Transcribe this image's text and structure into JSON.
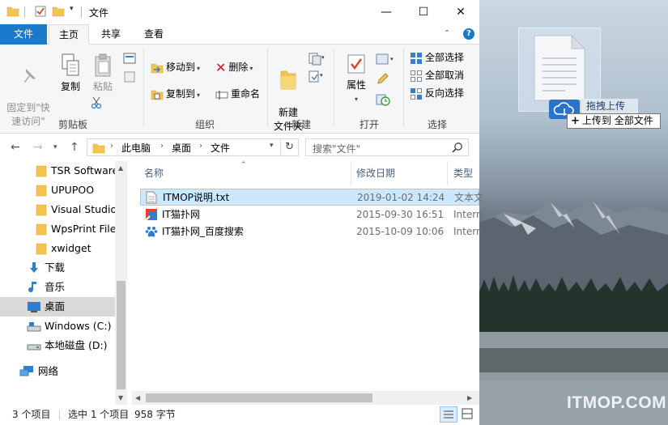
{
  "window": {
    "title": "文件",
    "controls": {
      "minimize": "—",
      "maximize": "☐",
      "close": "✕"
    }
  },
  "ribbon_tabs": {
    "file": "文件",
    "home": "主页",
    "share": "共享",
    "view": "查看",
    "help": "?"
  },
  "ribbon": {
    "clipboard": {
      "pin": "固定到\"快速访问\"",
      "copy": "复制",
      "paste": "粘贴",
      "label": "剪贴板"
    },
    "organize": {
      "move_to": "移动到",
      "copy_to": "复制到",
      "delete": "删除",
      "rename": "重命名",
      "label": "组织"
    },
    "new": {
      "new_folder": "新建\n文件夹",
      "label": "新建"
    },
    "open": {
      "properties": "属性",
      "label": "打开"
    },
    "select": {
      "select_all": "全部选择",
      "select_none": "全部取消",
      "invert": "反向选择",
      "label": "选择"
    }
  },
  "address": {
    "crumbs": [
      "此电脑",
      "桌面",
      "文件"
    ],
    "search_placeholder": "搜索\"文件\""
  },
  "nav_pane": [
    {
      "label": "TSR Software",
      "icon": "folder-icon"
    },
    {
      "label": "UPUPOO",
      "icon": "folder-icon"
    },
    {
      "label": "Visual Studio",
      "icon": "folder-icon"
    },
    {
      "label": "WpsPrint Files",
      "icon": "folder-icon"
    },
    {
      "label": "xwidget",
      "icon": "folder-icon"
    },
    {
      "label": "下载",
      "icon": "download-icon"
    },
    {
      "label": "音乐",
      "icon": "music-icon"
    },
    {
      "label": "桌面",
      "icon": "desktop-icon"
    },
    {
      "label": "Windows (C:)",
      "icon": "drive-c-icon"
    },
    {
      "label": "本地磁盘 (D:)",
      "icon": "drive-d-icon"
    },
    {
      "label": "网络",
      "icon": "network-icon"
    }
  ],
  "columns": {
    "name": "名称",
    "date": "修改日期",
    "type": "类型"
  },
  "files": [
    {
      "name": "ITMOP说明.txt",
      "date": "2019-01-02 14:24",
      "type": "文本文",
      "icon": "text-file-icon",
      "selected": true
    },
    {
      "name": "IT猫扑网",
      "date": "2015-09-30 16:51",
      "type": "Intern",
      "icon": "web-shortcut-icon",
      "selected": false
    },
    {
      "name": "IT猫扑网_百度搜索",
      "date": "2015-10-09 10:06",
      "type": "Intern",
      "icon": "baidu-shortcut-icon",
      "selected": false
    }
  ],
  "status": {
    "count": "3 个项目",
    "selection": "选中 1 个项目",
    "size": "958 字节"
  },
  "drag_overlay": {
    "label": "拖拽上传",
    "tooltip_symbol": "+",
    "tooltip": "上传到 全部文件"
  },
  "watermark": "ITMOP.COM",
  "colors": {
    "accent": "#1979ca",
    "selection": "#cce8ff",
    "selection_border": "#99d1ff",
    "folder": "#f3c450"
  }
}
